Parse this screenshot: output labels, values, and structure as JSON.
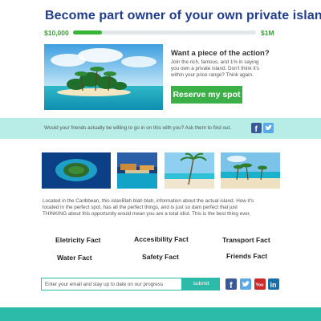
{
  "header": {
    "title": "Become part owner of your own private island"
  },
  "progress": {
    "min_label": "$10,000",
    "max_label": "$1M",
    "fraction": 0.16,
    "color": "#38b538"
  },
  "cta": {
    "heading": "Want a piece of the action?",
    "text_lines": [
      "Join the rich, famous, and 1% in saying",
      "you own a private island.  Don't think it's",
      "within your price range? Think again."
    ],
    "button_label": "Reserve my spot"
  },
  "share": {
    "text": "Would your friends actually be willing to go in on this with you? Ask them to find out.",
    "icons": [
      "facebook-icon",
      "twitter-icon"
    ]
  },
  "description": {
    "lines": [
      "Located in the Caribbean, this islanBlah blah blah, information about the actual island.  How it's",
      "located in the perfect spot, has all the perfect things, and is just so dam perfect that just",
      "THINKING about this opportunity would mean you are a total idiot.  This is the best thing ever,"
    ]
  },
  "facts": [
    "Eletricity Fact",
    "Accesibility Fact",
    "Transport Fact",
    "Water Fact",
    "Safety Fact",
    "Friends Fact"
  ],
  "signup": {
    "placeholder": "Enter your email and stay up to date on our progress",
    "submit_label": "submit"
  },
  "footer_social": [
    "facebook-icon",
    "twitter-icon",
    "youtube-icon",
    "linkedin-icon"
  ],
  "colors": {
    "title": "#1f3d8c",
    "accent_green": "#3bb046",
    "teal": "#2cbaa9",
    "light_teal": "#b7ece7"
  }
}
